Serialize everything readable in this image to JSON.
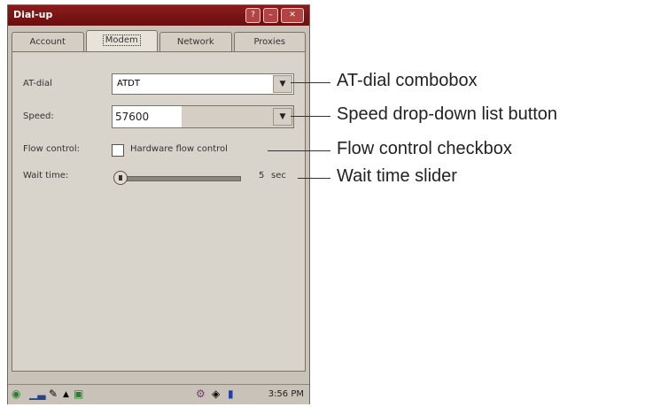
{
  "window": {
    "title": "Dial-up"
  },
  "tabs": [
    {
      "label": "Account"
    },
    {
      "label": "Modem"
    },
    {
      "label": "Network"
    },
    {
      "label": "Proxies"
    }
  ],
  "form": {
    "at_dial_label": "AT-dial",
    "at_dial_value": "ATDT",
    "speed_label": "Speed:",
    "speed_value": "57600",
    "flow_label": "Flow control:",
    "flow_checkbox_label": "Hardware flow control",
    "wait_label": "Wait time:",
    "wait_value": "5",
    "wait_unit": "sec"
  },
  "statusbar": {
    "clock": "3:56 PM"
  },
  "callouts": {
    "at_dial": "AT-dial combobox",
    "speed": "Speed drop-down list button",
    "flow": "Flow control checkbox",
    "wait": "Wait time slider"
  },
  "colors": {
    "titlebar": "#7a1414",
    "panel": "#d9d4cb"
  }
}
